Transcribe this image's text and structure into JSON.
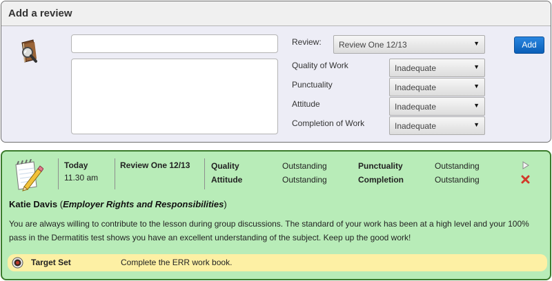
{
  "add_review": {
    "title": "Add a review",
    "icon": "review-book-magnifier-icon",
    "title_input": {
      "value": "",
      "placeholder": ""
    },
    "comment_textarea": {
      "value": "",
      "placeholder": ""
    },
    "review_label": "Review:",
    "review_select": "Review One 12/13",
    "add_button": "Add",
    "criteria": [
      {
        "label": "Quality of Work",
        "value": "Inadequate"
      },
      {
        "label": "Punctuality",
        "value": "Inadequate"
      },
      {
        "label": "Attitude",
        "value": "Inadequate"
      },
      {
        "label": "Completion of Work",
        "value": "Inadequate"
      }
    ]
  },
  "review_card": {
    "icon": "notepad-pencil-icon",
    "date": "Today",
    "time": "11.30 am",
    "review_name": "Review One 12/13",
    "ratings": [
      {
        "label": "Quality",
        "value": "Outstanding"
      },
      {
        "label": "Attitude",
        "value": "Outstanding"
      },
      {
        "label": "Punctuality",
        "value": "Outstanding"
      },
      {
        "label": "Completion",
        "value": "Outstanding"
      }
    ],
    "author": "Katie Davis",
    "course_open": "(",
    "course": "Employer Rights and Responsibilities",
    "course_close": ")",
    "body": "You are always willing to contribute to the lesson during group discussions. The standard of your work has been at a high level and your 100% pass in the Dermatitis test shows you have an excellent understanding of the subject. Keep up the good work!",
    "target": {
      "label": "Target Set",
      "text": "Complete the ERR work book."
    },
    "actions": {
      "view": "play-icon",
      "delete": "delete-x-icon"
    }
  },
  "colors": {
    "add_panel_bg": "#ededf6",
    "card_bg": "#b8ecb8",
    "card_border": "#3a7a2b",
    "target_bg": "#fdf0a4",
    "button_blue": "#1a73d0",
    "delete_red": "#d23a2a"
  }
}
